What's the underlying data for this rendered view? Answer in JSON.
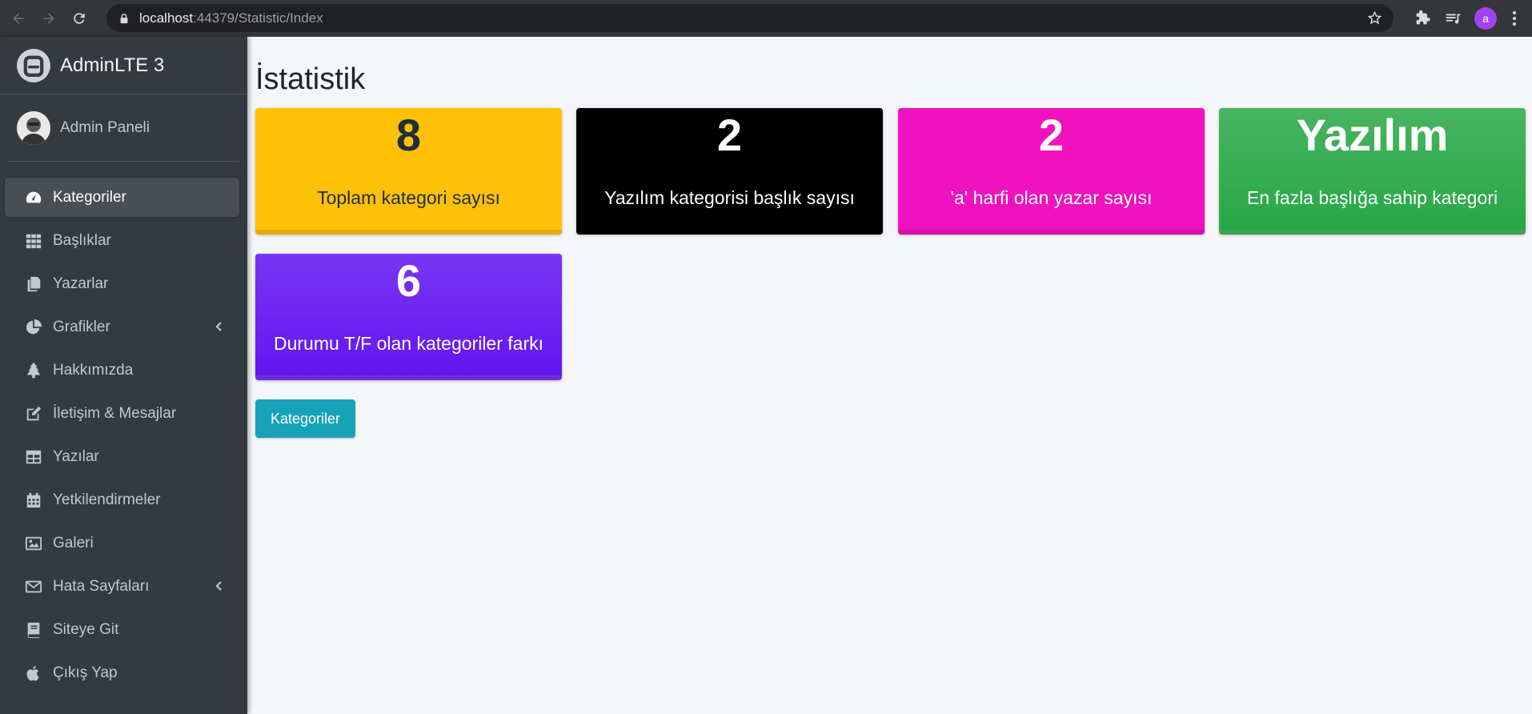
{
  "browser": {
    "url_host": "localhost",
    "url_path": ":44379/Statistic/Index",
    "profile_initial": "a"
  },
  "sidebar": {
    "brand": "AdminLTE 3",
    "user_name": "Admin Paneli",
    "items": [
      {
        "label": "Kategoriler",
        "icon": "tachometer-icon",
        "active": true
      },
      {
        "label": "Başlıklar",
        "icon": "grid-icon"
      },
      {
        "label": "Yazarlar",
        "icon": "copy-icon"
      },
      {
        "label": "Grafikler",
        "icon": "chart-pie-icon",
        "has_arrow": true
      },
      {
        "label": "Hakkımızda",
        "icon": "tree-icon"
      },
      {
        "label": "İletişim & Mesajlar",
        "icon": "edit-icon"
      },
      {
        "label": "Yazılar",
        "icon": "table-icon"
      },
      {
        "label": "Yetkilendirmeler",
        "icon": "calendar-icon"
      },
      {
        "label": "Galeri",
        "icon": "image-icon"
      },
      {
        "label": "Hata Sayfaları",
        "icon": "envelope-icon",
        "has_arrow": true
      },
      {
        "label": "Siteye Git",
        "icon": "book-icon"
      },
      {
        "label": "Çıkış Yap",
        "icon": "apple-icon"
      }
    ]
  },
  "main": {
    "title": "İstatistik",
    "boxes": [
      {
        "value": "8",
        "label": "Toplam kategori sayısı",
        "color": "#ffc107"
      },
      {
        "value": "2",
        "label": "Yazılım kategorisi başlık sayısı",
        "color": "#000000"
      },
      {
        "value": "2",
        "label": "'a' harfi olan yazar sayısı",
        "color": "#f012be"
      },
      {
        "value": "Yazılım",
        "label": "En fazla başlığa sahip kategori",
        "color": "#28a745"
      },
      {
        "value": "6",
        "label": "Durumu T/F olan kategoriler farkı",
        "color": "#6f22f0"
      }
    ],
    "button_label": "Kategoriler"
  }
}
